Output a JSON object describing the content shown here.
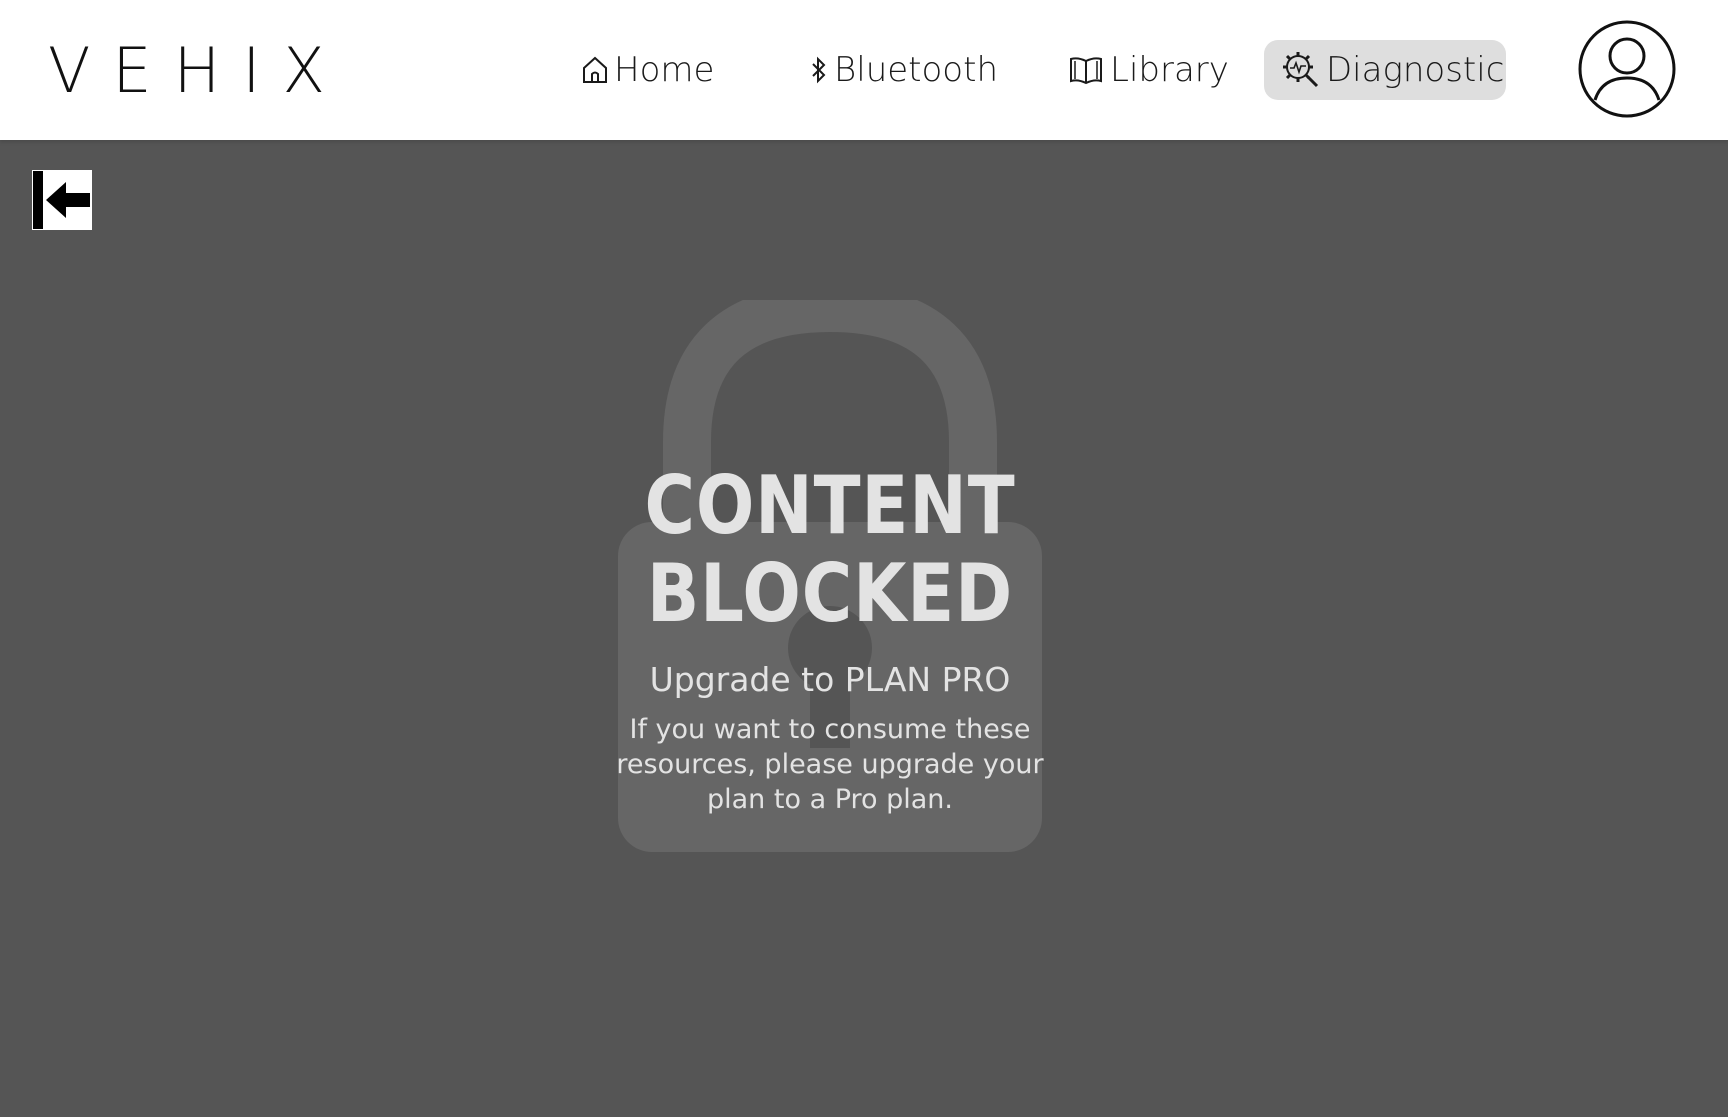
{
  "header": {
    "logo": "VEHIX",
    "nav": [
      {
        "label": "Home",
        "icon": "home-icon"
      },
      {
        "label": "Bluetooth",
        "icon": "bluetooth-icon"
      },
      {
        "label": "Library",
        "icon": "book-icon"
      },
      {
        "label": "Diagnostic",
        "icon": "diagnostic-gear-icon",
        "active": true
      }
    ],
    "avatar_icon": "user-avatar-icon"
  },
  "sidebar": {
    "collapse_icon": "collapse-arrow-icon"
  },
  "blocked": {
    "title_line1": "CONTENT",
    "title_line2": "BLOCKED",
    "subtitle": "Upgrade to PLAN PRO",
    "description": "If you want to consume these resources, please upgrade your plan to a Pro plan.",
    "background_icon": "lock-icon"
  },
  "colors": {
    "overlay": "#555555",
    "header_bg": "#ffffff",
    "active_nav_bg": "#dedede",
    "blocked_text": "#e3e3e3",
    "lock_shape": "#666666"
  }
}
